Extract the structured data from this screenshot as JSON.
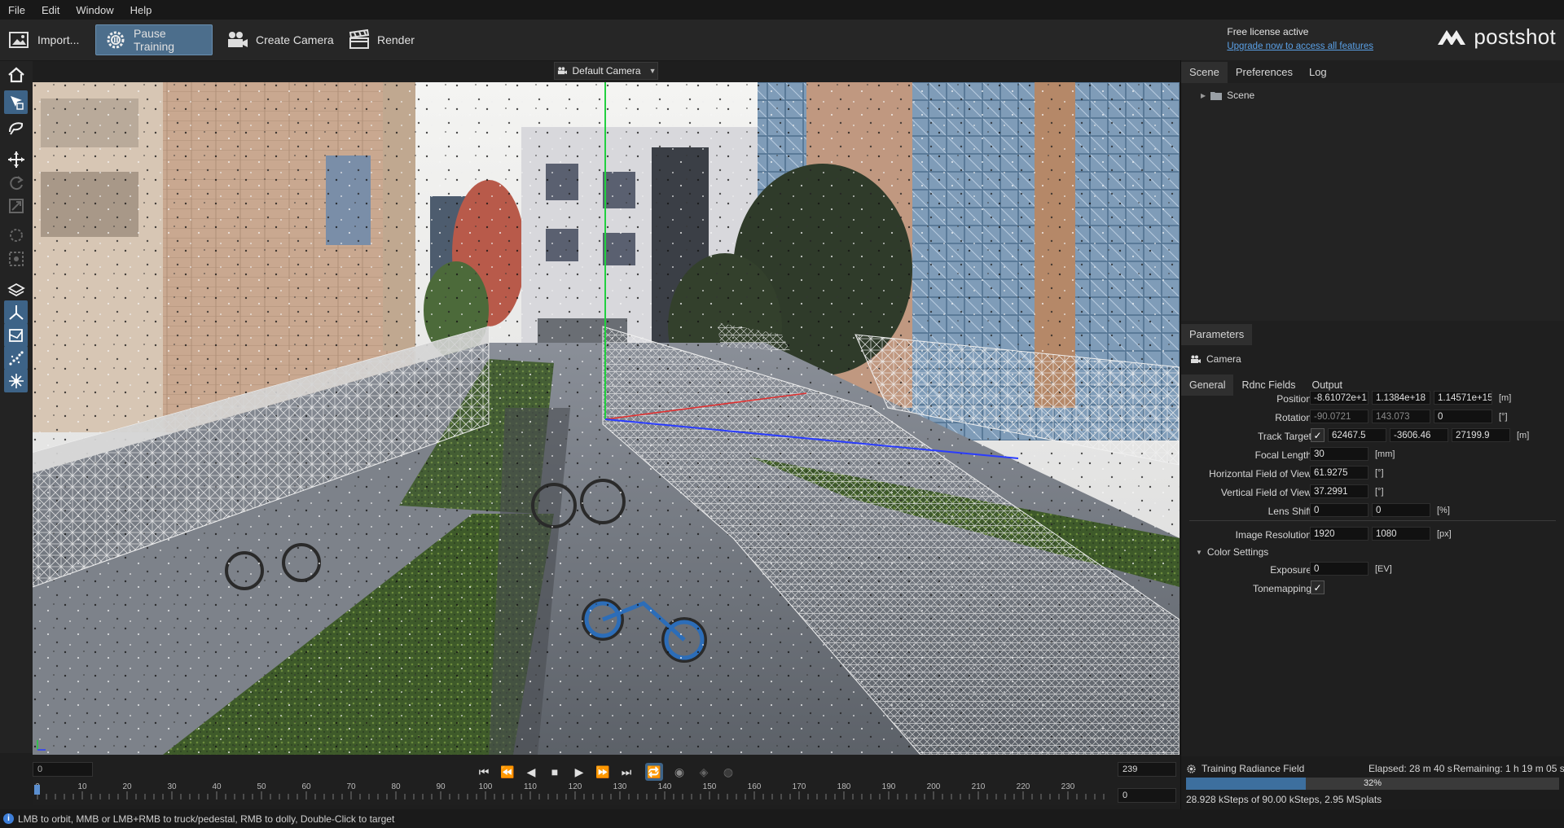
{
  "menu": [
    "File",
    "Edit",
    "Window",
    "Help"
  ],
  "toolbar": {
    "import_label": "Import...",
    "pause_label": "Pause Training",
    "create_camera_label": "Create Camera",
    "render_label": "Render"
  },
  "license": {
    "status": "Free license active",
    "upgrade": "Upgrade now to access all features"
  },
  "brand": "postshot",
  "viewport": {
    "camera": "Default Camera"
  },
  "right_panel": {
    "tabs": [
      "Scene",
      "Preferences",
      "Log"
    ],
    "scene_root": "Scene",
    "parameters_tab": "Parameters",
    "object_name": "Camera",
    "param_tabs": [
      "General",
      "Rdnc Fields",
      "Output"
    ],
    "params": {
      "position": {
        "label": "Position",
        "values": [
          "-8.61072e+1",
          "1.1384e+18",
          "1.14571e+15"
        ],
        "unit": "[m]"
      },
      "rotation": {
        "label": "Rotation",
        "values": [
          "-90.0721",
          "143.073",
          "0"
        ],
        "unit": "[°]"
      },
      "track_target": {
        "label": "Track Target",
        "values": [
          "62467.5",
          "-3606.46",
          "27199.9"
        ],
        "unit": "[m]",
        "checked": "✓"
      },
      "focal_length": {
        "label": "Focal Length",
        "value": "30",
        "unit": "[mm]"
      },
      "hfov": {
        "label": "Horizontal Field of View",
        "value": "61.9275",
        "unit": "[°]"
      },
      "vfov": {
        "label": "Vertical Field of View",
        "value": "37.2991",
        "unit": "[°]"
      },
      "lens_shift": {
        "label": "Lens Shift",
        "values": [
          "0",
          "0"
        ],
        "unit": "[%]"
      },
      "image_resolution": {
        "label": "Image Resolution",
        "values": [
          "1920",
          "1080"
        ],
        "unit": "[px]"
      },
      "color_settings": "Color Settings",
      "exposure": {
        "label": "Exposure",
        "value": "0",
        "unit": "[EV]"
      },
      "tonemapping": {
        "label": "Tonemapping",
        "checked": "✓"
      }
    }
  },
  "training": {
    "title": "Training Radiance Field",
    "elapsed": "Elapsed: 28 m 40 s",
    "remaining": "Remaining: 1 h 19 m 05 s",
    "progress_label": "32%",
    "progress": 0.32,
    "stats": "28.928 kSteps of 90.00 kSteps, 2.95 MSplats"
  },
  "timeline": {
    "start_frame": "0",
    "end_frame": "239",
    "current_frame": "0",
    "ticks": [
      "0",
      "10",
      "20",
      "30",
      "40",
      "50",
      "60",
      "70",
      "80",
      "90",
      "100",
      "110",
      "120",
      "130",
      "140",
      "150",
      "160",
      "170",
      "180",
      "190",
      "200",
      "210",
      "220",
      "230"
    ]
  },
  "status_hint": "LMB to orbit, MMB or LMB+RMB to truck/pedestal, RMB to dolly, Double-Click to target",
  "colors": {
    "accent": "#3d6387",
    "link": "#5aa0e6",
    "axis_x": "#e03030",
    "axis_y": "#22d040",
    "axis_z": "#2a3cff"
  }
}
